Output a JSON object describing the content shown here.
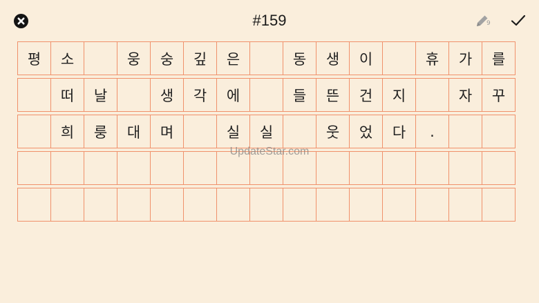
{
  "header": {
    "title": "#159",
    "pencil_count": "9",
    "icons": {
      "close": "close-circle-icon",
      "pencil": "pencil-icon",
      "check": "checkmark-icon"
    }
  },
  "colors": {
    "background": "#faeedc",
    "grid_line": "#f0906a",
    "text": "#1f1f1f",
    "pencil": "#9b9b9b"
  },
  "grid": {
    "rows": [
      [
        "평",
        "소",
        "",
        "웅",
        "숭",
        "깊",
        "은",
        "",
        "동",
        "생",
        "이",
        "",
        "휴",
        "가",
        "를"
      ],
      [
        "",
        "떠",
        "날",
        "",
        "생",
        "각",
        "에",
        "",
        "들",
        "뜬",
        "건",
        "지",
        "",
        "자",
        "꾸"
      ],
      [
        "",
        "희",
        "룽",
        "대",
        "며",
        "",
        "실",
        "실",
        "",
        "웃",
        "었",
        "다",
        ".",
        "",
        ""
      ],
      [
        "",
        "",
        "",
        "",
        "",
        "",
        "",
        "",
        "",
        "",
        "",
        "",
        "",
        "",
        ""
      ],
      [
        "",
        "",
        "",
        "",
        "",
        "",
        "",
        "",
        "",
        "",
        "",
        "",
        "",
        "",
        ""
      ]
    ]
  },
  "watermark": "UpdateStar.com"
}
